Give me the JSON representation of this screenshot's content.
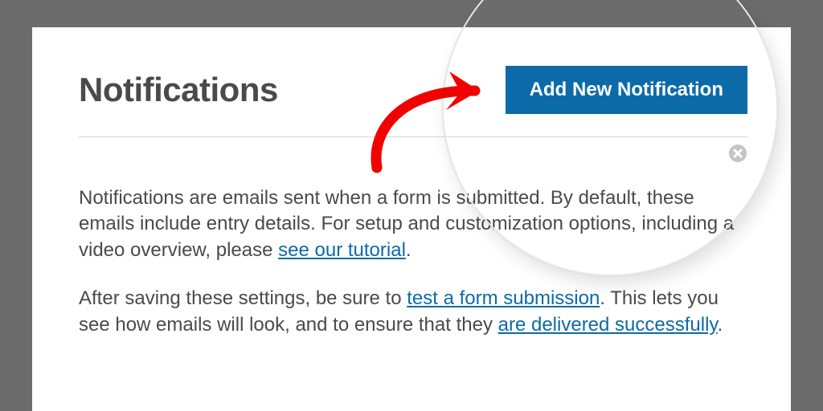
{
  "header": {
    "title": "Notifications",
    "add_button": "Add New Notification"
  },
  "info": {
    "dismiss_icon": "dismiss",
    "p1_a": "Notifications are emails sent when a form is submitted. By default, these emails include entry details. For setup and customization options, including a video overview, please ",
    "p1_link": "see our tutorial",
    "p1_b": ".",
    "p2_a": "After saving these settings, be sure to ",
    "p2_link1": "test a form submission",
    "p2_b": ". This lets you see how emails will look, and to ensure that they ",
    "p2_link2": "are delivered successfully",
    "p2_c": "."
  }
}
